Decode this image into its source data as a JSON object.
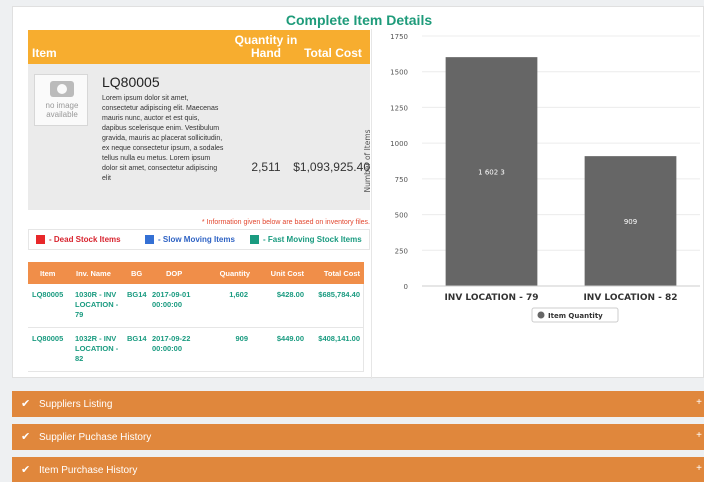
{
  "page_title": "Complete Item Details",
  "item_table": {
    "headers": {
      "item": "Item",
      "quantity": "Quantity in Hand",
      "total_cost": "Total Cost"
    },
    "image_placeholder": "no image available",
    "item_code": "LQ80005",
    "description": "Lorem ipsum dolor sit amet, consectetur adipiscing elit. Maecenas mauris nunc, auctor et est quis, dapibus scelerisque enim. Vestibulum gravida, mauris ac placerat sollicitudin, ex neque consectetur ipsum, a sodales tellus nulla eu metus. Lorem ipsum dolor sit amet, consectetur adipiscing elit",
    "quantity": "2,511",
    "total_cost": "$1,093,925.40"
  },
  "info_note": "* Information given below are based on inventory files.",
  "legend": {
    "dead": "- Dead Stock Items",
    "slow": "- Slow Moving Items",
    "fast": "- Fast Moving Stock Items"
  },
  "colors": {
    "dead": "#e8282a",
    "slow": "#3470d4",
    "fast": "#1a9b80",
    "title": "#1e9b7a",
    "header": "#f7ad2f",
    "accordion": "#e0873c"
  },
  "inventory_table": {
    "headers": [
      "Item",
      "Inv. Name",
      "BG",
      "DOP",
      "Quantity",
      "Unit Cost",
      "Total Cost"
    ],
    "rows": [
      {
        "item": "LQ80005",
        "inv_name": "1030R - INV LOCATION - 79",
        "bg": "BG14",
        "dop": "2017-09-01 00:00:00",
        "quantity": "1,602",
        "unit_cost": "$428.00",
        "total_cost": "$685,784.40"
      },
      {
        "item": "LQ80005",
        "inv_name": "1032R - INV LOCATION - 82",
        "bg": "BG14",
        "dop": "2017-09-22 00:00:00",
        "quantity": "909",
        "unit_cost": "$449.00",
        "total_cost": "$408,141.00"
      }
    ]
  },
  "chart_data": {
    "type": "bar",
    "categories": [
      "INV LOCATION - 79",
      "INV LOCATION - 82"
    ],
    "series": [
      {
        "name": "Item Quantity",
        "values": [
          1602,
          909
        ]
      }
    ],
    "data_labels": [
      "1 602 3",
      "909"
    ],
    "ylabel": "Number of Items",
    "xlabel": "",
    "ylim": [
      0,
      1750
    ],
    "yticks": [
      0,
      250,
      500,
      750,
      1000,
      1250,
      1500,
      1750
    ],
    "grid": true,
    "legend_position": "bottom",
    "bar_color": "#666666"
  },
  "accordions": [
    {
      "label": "Suppliers Listing",
      "toggle": "+"
    },
    {
      "label": "Supplier Puchase History",
      "toggle": "+"
    },
    {
      "label": "Item Purchase History",
      "toggle": "+"
    }
  ]
}
